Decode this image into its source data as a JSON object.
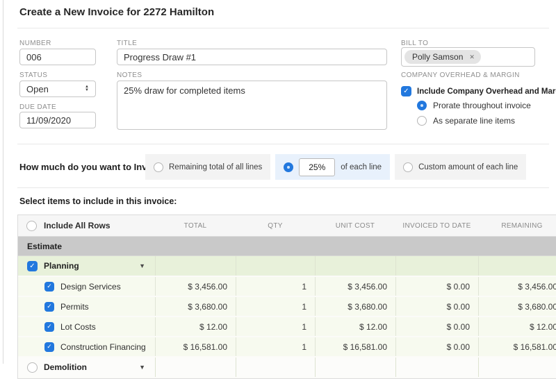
{
  "title": "Create a New Invoice for 2272 Hamilton",
  "icons": {
    "checkmark": "✓",
    "close": "✕",
    "caret_down": "▼",
    "arrow_up": "▲",
    "arrow_down": "▼"
  },
  "form": {
    "number": {
      "label": "NUMBER",
      "value": "006"
    },
    "invoice_title": {
      "label": "TITLE",
      "value": "Progress Draw #1"
    },
    "bill_to": {
      "label": "BILL TO",
      "recipient": "Polly Samson"
    },
    "status": {
      "label": "STATUS",
      "value": "Open"
    },
    "notes": {
      "label": "NOTES",
      "value": "25% draw for completed items"
    },
    "due_date": {
      "label": "DUE DATE",
      "value": "11/09/2020"
    },
    "overhead": {
      "label": "COMPANY OVERHEAD & MARGIN",
      "include_label": "Include Company Overhead and Margin",
      "include_checked": true,
      "options": [
        {
          "label": "Prorate throughout invoice",
          "selected": true
        },
        {
          "label": "As separate line items",
          "selected": false
        }
      ]
    }
  },
  "invoice_amount": {
    "question": "How much do you want to Invoice?",
    "options": [
      {
        "label": "Remaining total of all lines",
        "selected": false
      },
      {
        "value": "25%",
        "label": "of each line",
        "selected": true
      },
      {
        "label": "Custom amount of each line",
        "selected": false
      }
    ]
  },
  "items": {
    "heading": "Select items to include in this invoice:",
    "select_all": "Include All Rows",
    "columns": [
      "TOTAL",
      "QTY",
      "UNIT COST",
      "INVOICED TO DATE",
      "REMAINING"
    ],
    "group": "Estimate",
    "rows": [
      {
        "label": "Planning",
        "checked": true,
        "type": "category"
      },
      {
        "label": "Design Services",
        "checked": true,
        "total": "$ 3,456.00",
        "qty": "1",
        "unit_cost": "$ 3,456.00",
        "invoiced_to_date": "$ 0.00",
        "remaining": "$ 3,456.00"
      },
      {
        "label": "Permits",
        "checked": true,
        "total": "$ 3,680.00",
        "qty": "1",
        "unit_cost": "$ 3,680.00",
        "invoiced_to_date": "$ 0.00",
        "remaining": "$ 3,680.00"
      },
      {
        "label": "Lot Costs",
        "checked": true,
        "total": "$ 12.00",
        "qty": "1",
        "unit_cost": "$ 12.00",
        "invoiced_to_date": "$ 0.00",
        "remaining": "$ 12.00"
      },
      {
        "label": "Construction Financing",
        "checked": true,
        "total": "$ 16,581.00",
        "qty": "1",
        "unit_cost": "$ 16,581.00",
        "invoiced_to_date": "$ 0.00",
        "remaining": "$ 16,581.00"
      },
      {
        "label": "Demolition",
        "checked": false,
        "type": "category"
      }
    ]
  },
  "colors": {
    "accent_blue": "#2278de",
    "selected_option_bg": "#e8f1fc",
    "category_row_bg": "#e8f1da",
    "item_row_bg": "#f7faef",
    "group_row_bg": "#c9c9c9"
  }
}
